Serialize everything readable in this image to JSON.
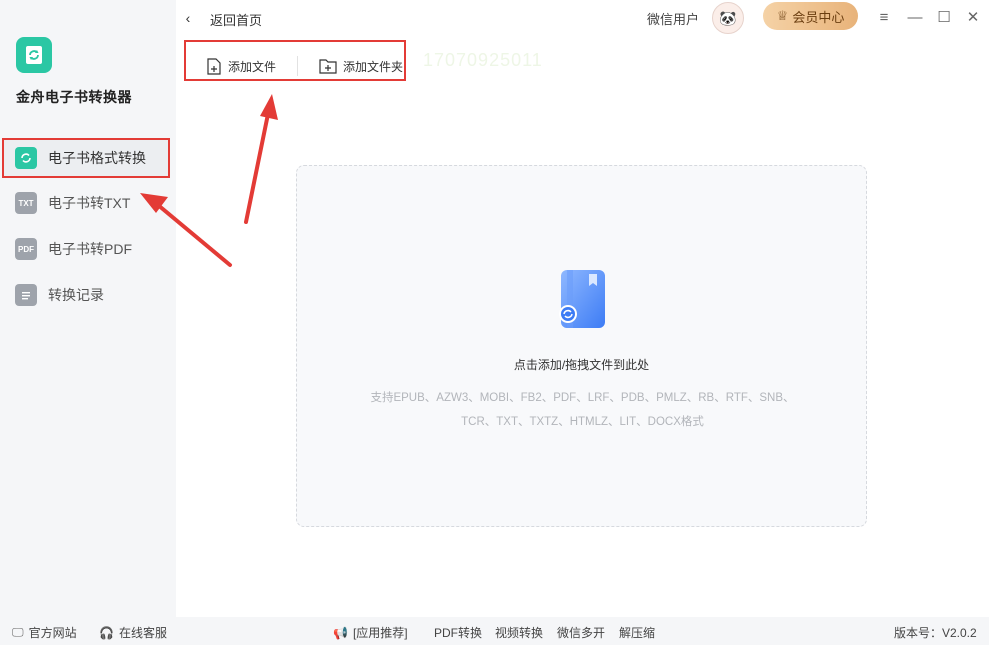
{
  "app": {
    "name": "金舟电子书转换器",
    "accent_color": "#2bc7a4",
    "highlight_color": "#e33b36"
  },
  "sidebar": {
    "items": [
      {
        "label": "电子书格式转换",
        "icon": "refresh-book-icon",
        "active": true
      },
      {
        "label": "电子书转TXT",
        "icon": "txt-file-icon",
        "badge": "TXT"
      },
      {
        "label": "电子书转PDF",
        "icon": "pdf-file-icon",
        "badge": "PDF"
      },
      {
        "label": "转换记录",
        "icon": "history-list-icon"
      }
    ]
  },
  "header": {
    "back_label": "返回首页",
    "user_name": "微信用户",
    "vip_label": "会员中心"
  },
  "toolbar": {
    "add_file": "添加文件",
    "add_folder": "添加文件夹",
    "ghost_text": "17070925011"
  },
  "dropzone": {
    "title": "点击添加/拖拽文件到此处",
    "hint_line1": "支持EPUB、AZW3、MOBI、FB2、PDF、LRF、PDB、PMLZ、RB、RTF、SNB、",
    "hint_line2": "TCR、TXT、TXTZ、HTMLZ、LIT、DOCX格式"
  },
  "footer": {
    "website": "官方网站",
    "support": "在线客服",
    "recommend": "[应用推荐]",
    "links": [
      "PDF转换",
      "视频转换",
      "微信多开",
      "解压缩"
    ],
    "version": "版本号：V2.0.2"
  }
}
